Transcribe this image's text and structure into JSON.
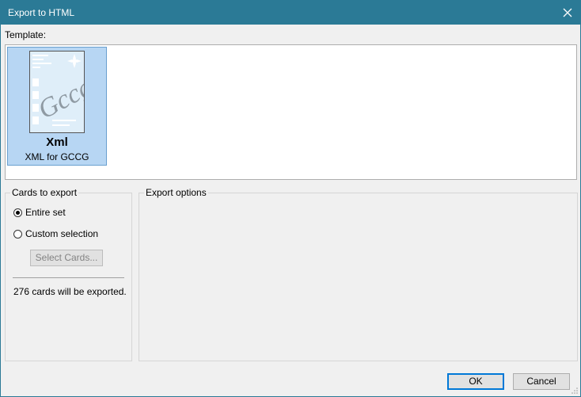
{
  "window": {
    "title": "Export to HTML"
  },
  "template": {
    "label": "Template:",
    "items": [
      {
        "name": "Xml",
        "description": "XML for GCCG",
        "thumbnail_text": "Gccg"
      }
    ]
  },
  "cards_to_export": {
    "title": "Cards to export",
    "option_entire": "Entire set",
    "option_custom": "Custom selection",
    "selected": "Entire set",
    "select_button": "Select Cards...",
    "status_text": "276 cards will be exported."
  },
  "export_options": {
    "title": "Export options"
  },
  "buttons": {
    "ok": "OK",
    "cancel": "Cancel"
  },
  "colors": {
    "titlebar": "#2b7a96",
    "selection": "#b7d6f3",
    "default_button_border": "#0078d7"
  },
  "icons": {
    "close": "close-icon",
    "resize": "resize-grip-icon",
    "thumbnail": "gccg-template-thumbnail"
  }
}
